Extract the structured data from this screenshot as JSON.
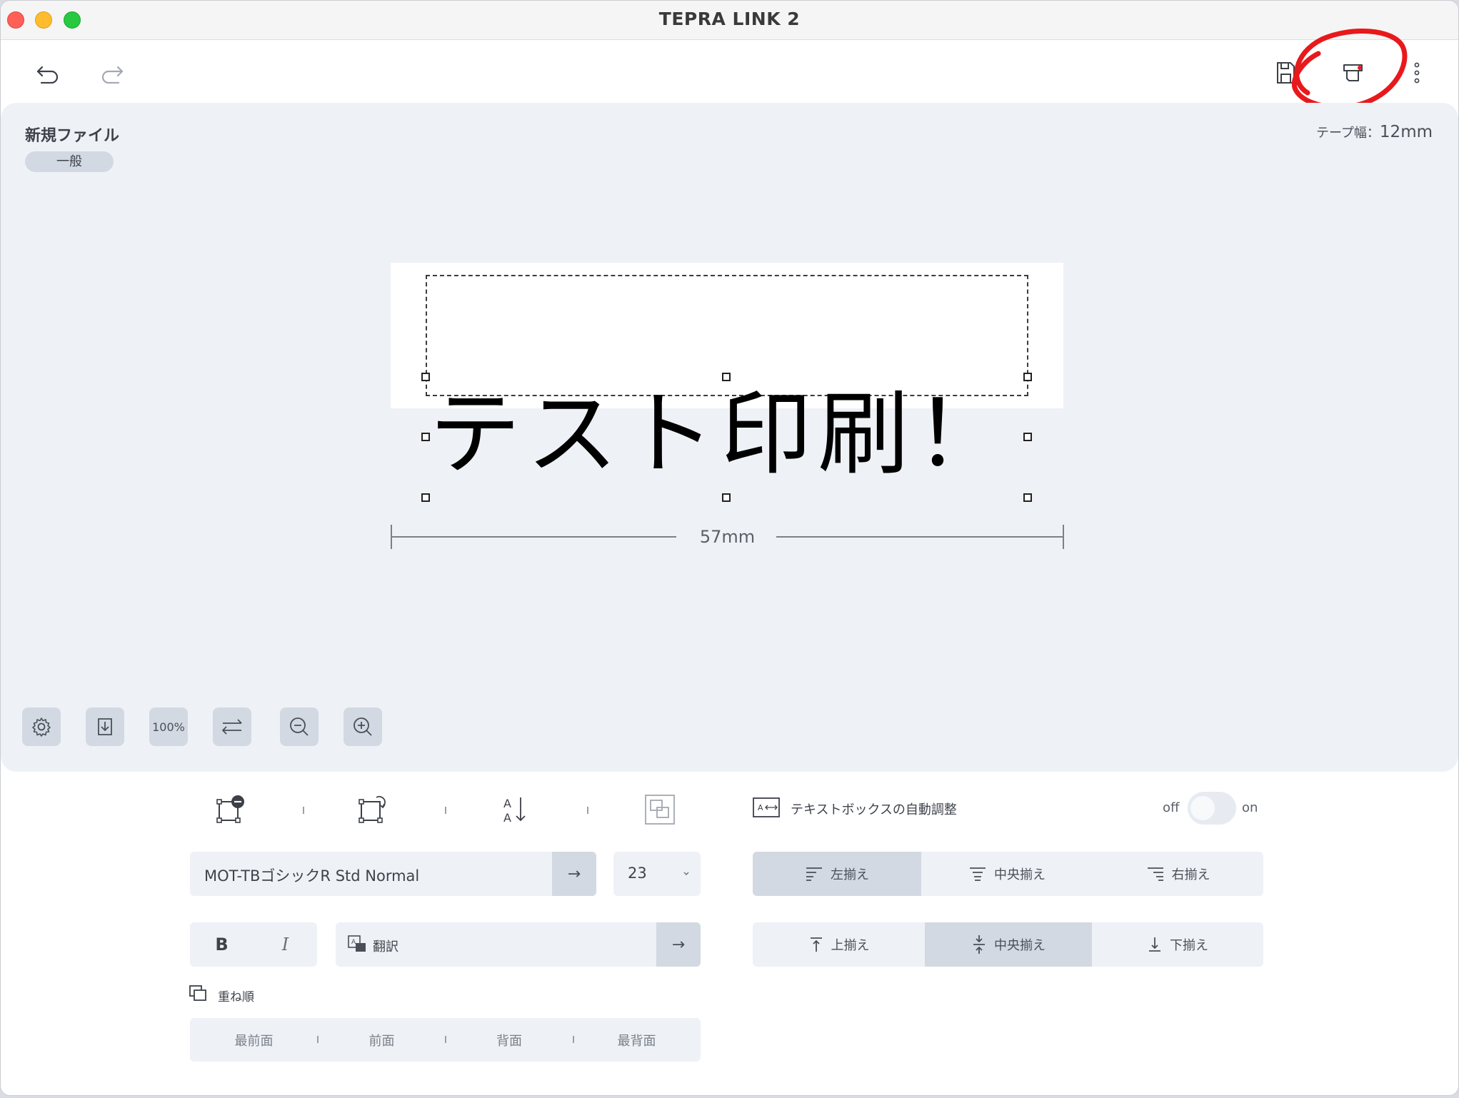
{
  "window": {
    "title": "TEPRA LINK 2"
  },
  "file": {
    "name": "新規ファイル",
    "category": "一般"
  },
  "tape": {
    "label": "テープ幅：",
    "value": "12mm"
  },
  "label": {
    "text": "テスト印刷！",
    "length": "57mm"
  },
  "zoom": {
    "level": "100%"
  },
  "font": {
    "family": "MOT-TBゴシックR Std Normal",
    "size": "23",
    "arrow": "→"
  },
  "style": {
    "bold": "B",
    "italic": "I"
  },
  "translate": {
    "label": "翻訳",
    "arrow": "→"
  },
  "autofit": {
    "label": "テキストボックスの自動調整",
    "off": "off",
    "on": "on",
    "state": "off"
  },
  "halign": {
    "options": [
      "左揃え",
      "中央揃え",
      "右揃え"
    ],
    "selected": "左揃え"
  },
  "valign": {
    "options": [
      "上揃え",
      "中央揃え",
      "下揃え"
    ],
    "selected": "中央揃え"
  },
  "order": {
    "title": "重ね順",
    "options": [
      "最前面",
      "前面",
      "背面",
      "最背面"
    ]
  },
  "annotation": {
    "color": "#e8191c",
    "target": "print-preview-icon"
  }
}
